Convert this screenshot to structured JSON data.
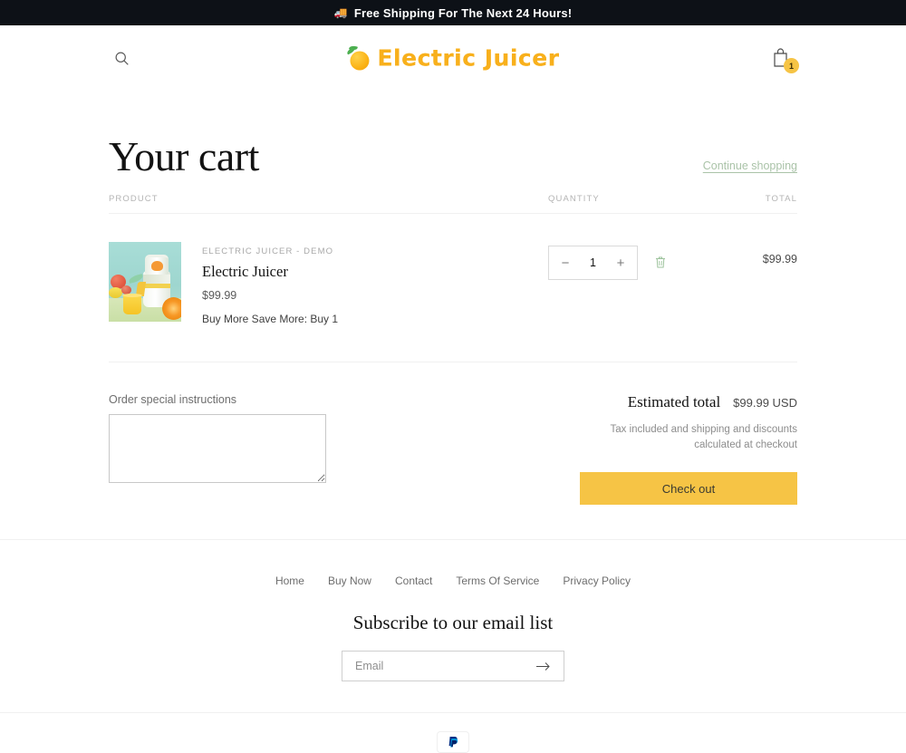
{
  "announcement": {
    "icon": "truck-icon",
    "text": "Free Shipping For The Next 24 Hours!"
  },
  "header": {
    "search_icon": "search-icon",
    "logo_text": "Electric Juicer",
    "logo_icon": "orange-fruit-icon",
    "cart_icon": "shopping-bag-icon",
    "cart_count": "1"
  },
  "cart": {
    "title": "Your cart",
    "continue_link": "Continue shopping",
    "headers": {
      "product": "PRODUCT",
      "quantity": "QUANTITY",
      "total": "TOTAL"
    },
    "items": [
      {
        "vendor": "ELECTRIC JUICER - DEMO",
        "title": "Electric Juicer",
        "price": "$99.99",
        "property": "Buy More Save More: Buy 1",
        "quantity": "1",
        "minus_label": "−",
        "plus_label": "+",
        "remove_icon": "trash-icon",
        "line_total": "$99.99"
      }
    ],
    "notes_label": "Order special instructions",
    "notes_value": "",
    "notes_placeholder": "",
    "totals_label": "Estimated total",
    "totals_value": "$99.99 USD",
    "tax_note": "Tax included and shipping and discounts calculated at checkout",
    "checkout_label": "Check out"
  },
  "footer": {
    "links": [
      {
        "label": "Home"
      },
      {
        "label": "Buy Now"
      },
      {
        "label": "Contact"
      },
      {
        "label": "Terms Of Service"
      },
      {
        "label": "Privacy Policy"
      }
    ],
    "subscribe_title": "Subscribe to our email list",
    "email_placeholder": "Email",
    "email_value": "",
    "submit_icon": "arrow-right-icon",
    "payment_icons": [
      {
        "name": "paypal-icon"
      }
    ]
  },
  "colors": {
    "accent": "#f6c445",
    "announcement_bg": "#0d1117",
    "logo": "#f8b01c",
    "link_green": "#aac3a8"
  }
}
